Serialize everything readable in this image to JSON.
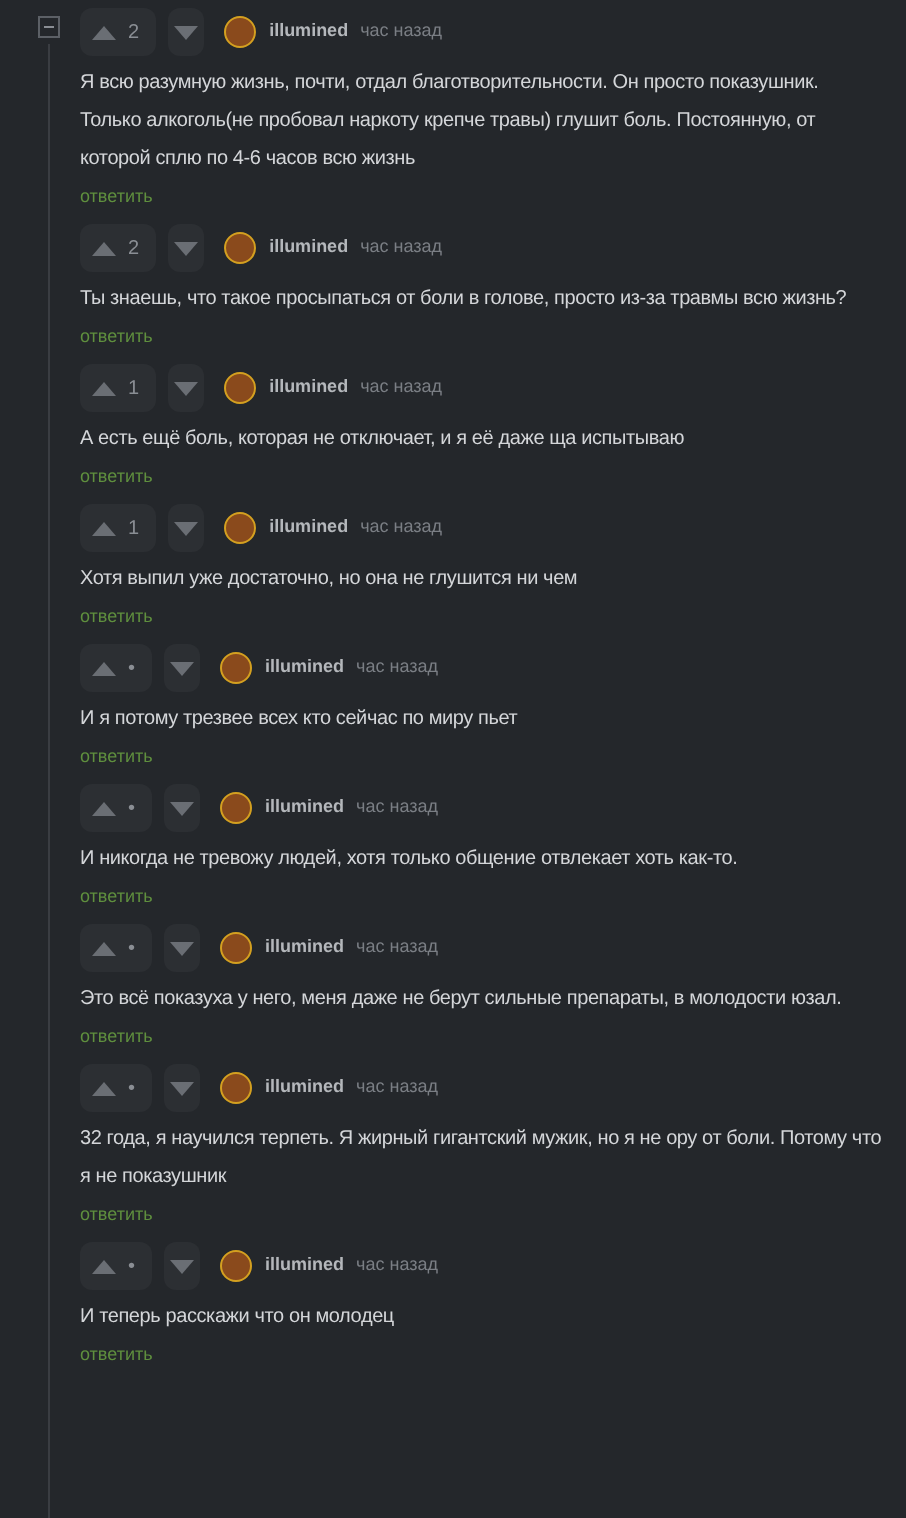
{
  "comments": [
    {
      "votes": "2",
      "author": "illumined",
      "time": "час назад",
      "text": "Я всю разумную жизнь, почти, отдал благотворительности. Он просто показушник. Только алкоголь(не пробовал наркоту крепче травы) глушит боль. Постоянную, от которой сплю по 4-6 часов всю жизнь",
      "reply": "ответить"
    },
    {
      "votes": "2",
      "author": "illumined",
      "time": "час назад",
      "text": "Ты знаешь, что такое просыпаться от боли в голове, просто из-за травмы всю жизнь?",
      "reply": "ответить"
    },
    {
      "votes": "1",
      "author": "illumined",
      "time": "час назад",
      "text": "А есть ещё боль, которая не отключает, и я её даже ща испытываю",
      "reply": "ответить"
    },
    {
      "votes": "1",
      "author": "illumined",
      "time": "час назад",
      "text": "Хотя выпил уже достаточно, но она не глушится ни чем",
      "reply": "ответить"
    },
    {
      "votes": "•",
      "author": "illumined",
      "time": "час назад",
      "text": "И я потому трезвее всех кто сейчас по миру пьет",
      "reply": "ответить"
    },
    {
      "votes": "•",
      "author": "illumined",
      "time": "час назад",
      "text": "И никогда не тревожу людей, хотя только общение отвлекает хоть как-то.",
      "reply": "ответить"
    },
    {
      "votes": "•",
      "author": "illumined",
      "time": "час назад",
      "text": "Это всё показуха у него, меня даже не берут сильные препараты, в молодости юзал.",
      "reply": "ответить"
    },
    {
      "votes": "•",
      "author": "illumined",
      "time": "час назад",
      "text": "32 года, я научился терпеть. Я жирный гигантский мужик, но я не ору от боли. Потому что я не показушник",
      "reply": "ответить"
    },
    {
      "votes": "•",
      "author": "illumined",
      "time": "час назад",
      "text": "И теперь расскажи что он молодец",
      "reply": "ответить"
    }
  ]
}
